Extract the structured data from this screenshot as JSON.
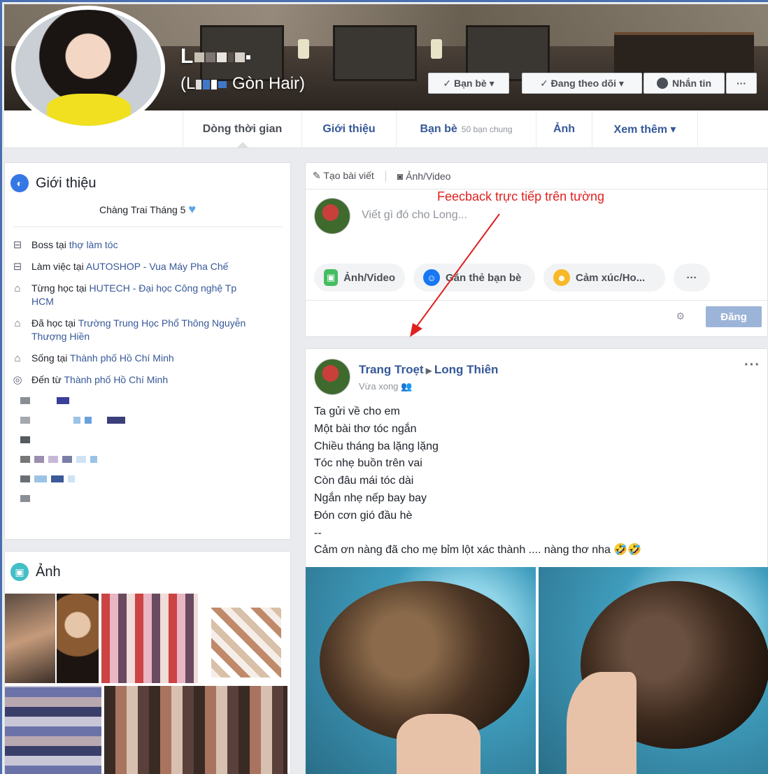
{
  "profile": {
    "name_line1": "L",
    "name_line2_prefix": "(L",
    "name_line2_suffix": "Gòn Hair)"
  },
  "cover_buttons": {
    "friends": "✓ Bạn bè ▾",
    "following": "✓ Đang theo dõi ▾",
    "message": "Nhắn tin",
    "more": "···"
  },
  "nav": {
    "timeline": "Dòng thời gian",
    "about": "Giới thiệu",
    "friends": "Bạn bè",
    "friends_sub": "50 bạn chung",
    "photos": "Ảnh",
    "more": "Xem thêm ▾"
  },
  "intro": {
    "title": "Giới thiệu",
    "bio": "Chàng Trai Tháng 5",
    "rows": [
      {
        "prefix": "Boss tại",
        "link": "thợ làm tóc"
      },
      {
        "prefix": "Làm việc tại",
        "link": "AUTOSHOP - Vua Máy Pha Chế"
      },
      {
        "prefix": "Từng học tại",
        "link": "HUTECH - Đại học Công nghệ Tp HCM"
      },
      {
        "prefix": "Đã học tại",
        "link": "Trường Trung Học Phổ Thông Nguyễn Thượng Hiền"
      },
      {
        "prefix": "Sống tại",
        "link": "Thành phố Hồ Chí Minh"
      },
      {
        "prefix": "Đến từ",
        "link": "Thành phố Hồ Chí Minh"
      }
    ]
  },
  "photos": {
    "title": "Ảnh"
  },
  "composer": {
    "tab_post": "Tạo bài viết",
    "tab_photo": "Ảnh/Video",
    "placeholder": "Viết gì đó cho Long...",
    "annotation": "Feecback trực tiếp trên tường",
    "chip_photo": "Ảnh/Video",
    "chip_tag": "Gắn thẻ bạn bè",
    "chip_feeling": "Cảm xúc/Ho...",
    "chip_more": "···",
    "post_button": "Đăng"
  },
  "post": {
    "author": "Trang Troẹt",
    "target": "Long Thiên",
    "time": "Vừa xong",
    "more": "···",
    "lines": [
      "Ta gửi về cho em",
      "Một bài thơ tóc ngắn",
      "Chiều tháng ba lặng lặng",
      "Tóc nhẹ buồn trên vai",
      "Còn đâu mái tóc dài",
      "Ngắn nhẹ nếp bay bay",
      "Đón cơn gió đầu hè",
      "--",
      "Cảm ơn nàng đã cho mẹ bỉm lột xác thành .... nàng thơ nha 🤣🤣"
    ]
  },
  "colors": {
    "link": "#365899",
    "annotation_red": "#e02020",
    "post_button": "#9cb4d8"
  }
}
